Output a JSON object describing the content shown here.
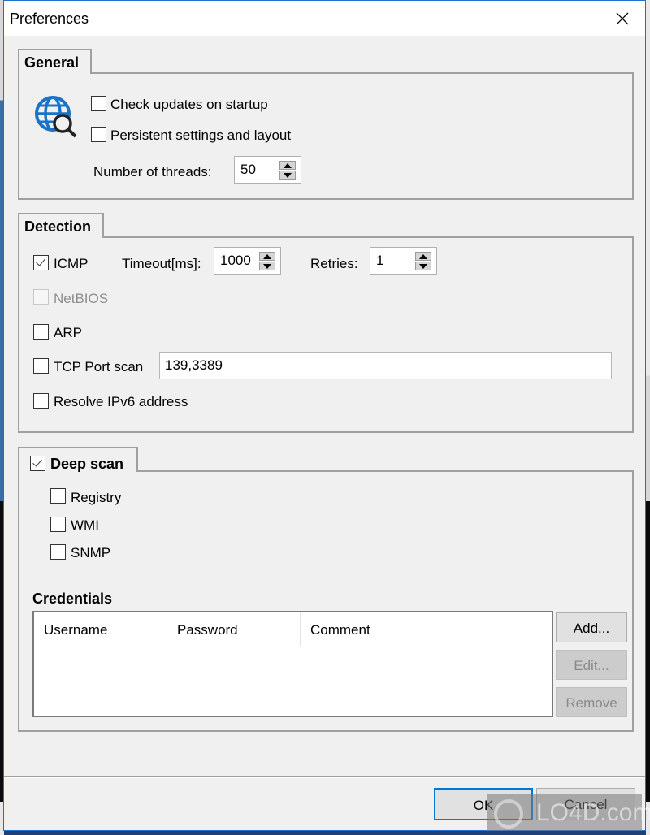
{
  "window": {
    "title": "Preferences",
    "close_icon": "close-icon"
  },
  "general": {
    "tab_label": "General",
    "icon": "globe-search-icon",
    "check_updates": {
      "label": "Check updates on startup",
      "checked": false
    },
    "persistent_settings": {
      "label": "Persistent settings and layout",
      "checked": false
    },
    "threads": {
      "label": "Number of threads:",
      "value": "50"
    }
  },
  "detection": {
    "tab_label": "Detection",
    "icmp": {
      "label": "ICMP",
      "checked": true
    },
    "timeout": {
      "label": "Timeout[ms]:",
      "value": "1000"
    },
    "retries": {
      "label": "Retries:",
      "value": "1"
    },
    "netbios": {
      "label": "NetBIOS",
      "checked": false,
      "disabled": true
    },
    "arp": {
      "label": "ARP",
      "checked": false
    },
    "tcp_port_scan": {
      "label": "TCP Port scan",
      "checked": false,
      "ports": "139,3389"
    },
    "resolve_ipv6": {
      "label": "Resolve IPv6 address",
      "checked": false
    }
  },
  "deep_scan": {
    "tab_label": "Deep scan",
    "checked": true,
    "registry": {
      "label": "Registry",
      "checked": false
    },
    "wmi": {
      "label": "WMI",
      "checked": false
    },
    "snmp": {
      "label": "SNMP",
      "checked": false
    },
    "credentials": {
      "title": "Credentials",
      "columns": [
        "Username",
        "Password",
        "Comment"
      ],
      "rows": [],
      "add_label": "Add...",
      "edit_label": "Edit...",
      "remove_label": "Remove"
    }
  },
  "footer": {
    "ok_label": "OK",
    "cancel_label": "Cancel"
  },
  "watermark": {
    "text": "LO4D.com"
  }
}
